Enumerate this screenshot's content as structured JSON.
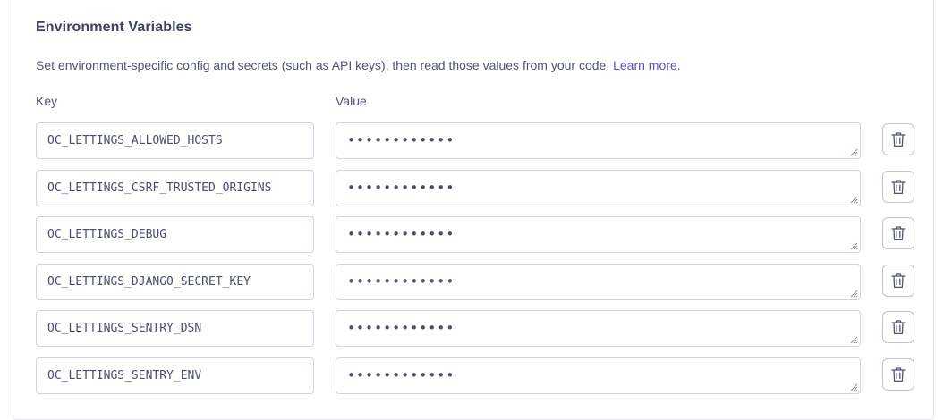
{
  "section": {
    "title": "Environment Variables",
    "description": "Set environment-specific config and secrets (such as API keys), then read those values from your code.",
    "learn_more": "Learn more",
    "description_suffix": "."
  },
  "columns": {
    "key": "Key",
    "value": "Value"
  },
  "env_vars": [
    {
      "key": "OC_LETTINGS_ALLOWED_HOSTS",
      "value_masked": "••••••••••••"
    },
    {
      "key": "OC_LETTINGS_CSRF_TRUSTED_ORIGINS",
      "value_masked": "••••••••••••"
    },
    {
      "key": "OC_LETTINGS_DEBUG",
      "value_masked": "••••••••••••"
    },
    {
      "key": "OC_LETTINGS_DJANGO_SECRET_KEY",
      "value_masked": "••••••••••••"
    },
    {
      "key": "OC_LETTINGS_SENTRY_DSN",
      "value_masked": "••••••••••••"
    },
    {
      "key": "OC_LETTINGS_SENTRY_ENV",
      "value_masked": "••••••••••••"
    }
  ],
  "colors": {
    "link": "#5b4fd1",
    "text": "#3e4160",
    "border": "#cfd3e4"
  },
  "icons": {
    "delete": "trash-icon",
    "resize": "resize-handle-icon"
  }
}
